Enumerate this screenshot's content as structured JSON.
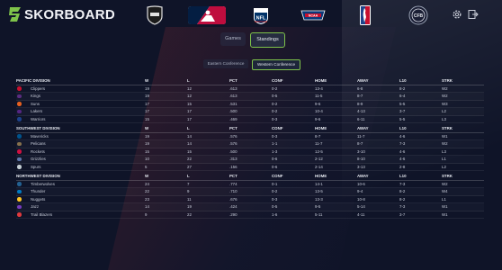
{
  "app": {
    "title": "SKORBOARD"
  },
  "leagues": [
    {
      "name": "NHL",
      "icon": "nhl-logo-icon"
    },
    {
      "name": "MLB",
      "icon": "mlb-logo-icon"
    },
    {
      "name": "NFL",
      "icon": "nfl-logo-icon"
    },
    {
      "name": "NCAA",
      "icon": "ncaa-logo-icon"
    },
    {
      "name": "NBA",
      "icon": "nba-logo-icon"
    },
    {
      "name": "CFB",
      "icon": "cfb-logo-icon"
    }
  ],
  "header": {
    "settings_icon": "gear-icon",
    "exit_icon": "exit-icon"
  },
  "tabs": [
    {
      "label": "Games",
      "active": false
    },
    {
      "label": "Standings",
      "active": true
    }
  ],
  "conference_tabs": [
    {
      "label": "Eastern Conference",
      "active": false
    },
    {
      "label": "Western Conference",
      "active": true
    }
  ],
  "columns": [
    "W",
    "L",
    "PCT",
    "CONF",
    "HOME",
    "AWAY",
    "L10",
    "STRK"
  ],
  "divisions": [
    {
      "name": "PACIFIC DIVISION",
      "teams": [
        {
          "team": "Clippers",
          "w": "19",
          "l": "12",
          "pct": ".613",
          "conf": "0-2",
          "home": "13-4",
          "away": "6-8",
          "l10": "8-2",
          "strk": "W2",
          "color": "#c8102e"
        },
        {
          "team": "Kings",
          "w": "19",
          "l": "12",
          "pct": ".613",
          "conf": "0-5",
          "home": "11-5",
          "away": "8-7",
          "l10": "6-4",
          "strk": "W2",
          "color": "#5a2d81"
        },
        {
          "team": "Suns",
          "w": "17",
          "l": "15",
          "pct": ".531",
          "conf": "0-2",
          "home": "9-6",
          "away": "8-9",
          "l10": "5-5",
          "strk": "W3",
          "color": "#e56020"
        },
        {
          "team": "Lakers",
          "w": "17",
          "l": "17",
          "pct": ".500",
          "conf": "0-2",
          "home": "10-4",
          "away": "4-13",
          "l10": "3-7",
          "strk": "L2",
          "color": "#552583"
        },
        {
          "team": "Warriors",
          "w": "15",
          "l": "17",
          "pct": ".469",
          "conf": "0-3",
          "home": "9-6",
          "away": "6-11",
          "l10": "5-5",
          "strk": "L3",
          "color": "#1d428a"
        }
      ]
    },
    {
      "name": "SOUTHWEST DIVISION",
      "teams": [
        {
          "team": "Mavericks",
          "w": "19",
          "l": "14",
          "pct": ".576",
          "conf": "0-3",
          "home": "8-7",
          "away": "11-7",
          "l10": "4-6",
          "strk": "W1",
          "color": "#00538c"
        },
        {
          "team": "Pelicans",
          "w": "19",
          "l": "14",
          "pct": ".576",
          "conf": "1-1",
          "home": "11-7",
          "away": "8-7",
          "l10": "7-3",
          "strk": "W2",
          "color": "#85714d"
        },
        {
          "team": "Rockets",
          "w": "15",
          "l": "15",
          "pct": ".500",
          "conf": "1-3",
          "home": "12-5",
          "away": "3-10",
          "l10": "4-6",
          "strk": "L3",
          "color": "#ce1141"
        },
        {
          "team": "Grizzlies",
          "w": "10",
          "l": "22",
          "pct": ".313",
          "conf": "0-6",
          "home": "2-12",
          "away": "8-10",
          "l10": "4-6",
          "strk": "L1",
          "color": "#5d76a9"
        },
        {
          "team": "Spurs",
          "w": "5",
          "l": "27",
          "pct": ".156",
          "conf": "0-6",
          "home": "2-14",
          "away": "3-13",
          "l10": "2-8",
          "strk": "L2",
          "color": "#c4ced4"
        }
      ]
    },
    {
      "name": "NORTHWEST DIVISION",
      "teams": [
        {
          "team": "Timberwolves",
          "w": "24",
          "l": "7",
          "pct": ".774",
          "conf": "0-1",
          "home": "14-1",
          "away": "10-6",
          "l10": "7-3",
          "strk": "W2",
          "color": "#236192"
        },
        {
          "team": "Thunder",
          "w": "22",
          "l": "9",
          "pct": ".710",
          "conf": "0-2",
          "home": "13-5",
          "away": "9-4",
          "l10": "8-2",
          "strk": "W4",
          "color": "#007ac1"
        },
        {
          "team": "Nuggets",
          "w": "23",
          "l": "11",
          "pct": ".676",
          "conf": "0-3",
          "home": "13-3",
          "away": "10-8",
          "l10": "8-2",
          "strk": "L1",
          "color": "#fec524"
        },
        {
          "team": "Jazz",
          "w": "14",
          "l": "19",
          "pct": ".424",
          "conf": "0-5",
          "home": "9-5",
          "away": "5-14",
          "l10": "7-3",
          "strk": "W1",
          "color": "#753bbd"
        },
        {
          "team": "Trail Blazers",
          "w": "9",
          "l": "22",
          "pct": ".290",
          "conf": "1-6",
          "home": "5-11",
          "away": "4-11",
          "l10": "3-7",
          "strk": "W1",
          "color": "#e03a3e"
        }
      ]
    }
  ]
}
